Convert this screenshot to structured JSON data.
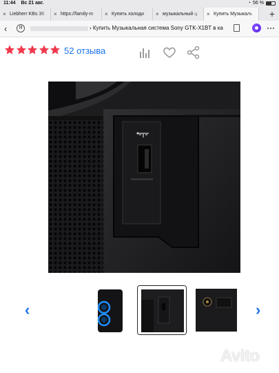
{
  "status_bar": {
    "time": "11:44",
    "date": "Вс 21 авг.",
    "battery": "56 %"
  },
  "tabs": [
    {
      "label": "Liebherr KBs 38"
    },
    {
      "label": "https://family-m"
    },
    {
      "label": "Купить холоди"
    },
    {
      "label": "музыкальный ц"
    },
    {
      "label": "Купить Музыкаль"
    }
  ],
  "url": {
    "title": "› Купить Музыкальная система Sony GTK-X1BT в ка"
  },
  "rating": {
    "stars": 5,
    "reviews": "52 отзыва"
  },
  "colors": {
    "star": "#f03a4d",
    "link": "#1a73e8",
    "accent": "#8a4dff"
  },
  "icons": [
    "chart-icon",
    "heart-icon",
    "share-icon",
    "chevron-left-icon",
    "chevron-right-icon"
  ],
  "watermark": "Avito"
}
